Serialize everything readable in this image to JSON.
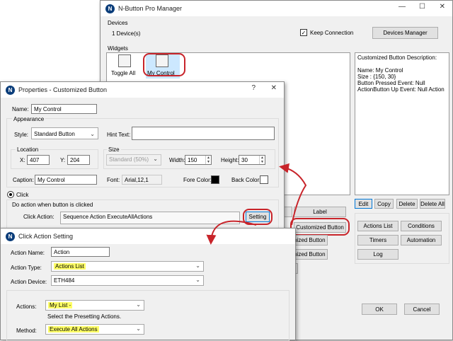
{
  "manager": {
    "title": "N-Button Pro Manager",
    "devices_label": "Devices",
    "device_count": "1 Device(s)",
    "keep_connection": "Keep Connection",
    "keep_connection_checked": true,
    "devices_manager_btn": "Devices Manager",
    "widgets_label": "Widgets",
    "widget_toggle_all": "Toggle All",
    "widget_my_control": "My Control",
    "desc_title": "Customized Button Description:",
    "desc_lines": [
      "Name: My Control",
      "Size : {150, 30}",
      "Button Pressed Event: Null",
      "ActionButton Up Event: Null Action"
    ],
    "btn_edit": "Edit",
    "btn_copy": "Copy",
    "btn_delete": "Delete",
    "btn_delete_all": "Delete All",
    "btn_label": "Label",
    "btn_customized_button": "Customized Button",
    "btn_customized_2": "omized Button",
    "btn_customized_3": "omized Button",
    "btn_actions_list": "Actions List",
    "btn_conditions": "Conditions",
    "btn_timers": "Timers",
    "btn_automation": "Automation",
    "btn_log": "Log",
    "btn_ok": "OK",
    "btn_cancel": "Cancel"
  },
  "props": {
    "title": "Properties - Customized Button",
    "name_label": "Name:",
    "name_value": "My Control",
    "appearance_label": "Appearance",
    "style_label": "Style:",
    "style_value": "Standard Button",
    "hint_label": "Hint Text:",
    "hint_value": "",
    "location_label": "Location",
    "x_label": "X:",
    "x_value": "407",
    "y_label": "Y:",
    "y_value": "204",
    "size_label": "Size",
    "size_combo": "Standard   (50%)",
    "width_label": "Width:",
    "width_value": "150",
    "height_label": "Height:",
    "height_value": "30",
    "caption_label": "Caption:",
    "caption_value": "My Control",
    "font_label": "Font:",
    "font_value": "Arial,12,1",
    "fore_label": "Fore Color:",
    "fore_color": "#000000",
    "back_label": "Back Color:",
    "back_color": "#ffffff",
    "click_label": "Click",
    "do_action_label": "Do action when button is clicked",
    "click_action_label": "Click Action:",
    "click_action_value": "Sequence Action ExecuteAllActions",
    "setting_btn": "Setting"
  },
  "cas": {
    "title": "Click Action Setting",
    "action_name_label": "Action Name:",
    "action_name_value": "Action",
    "action_type_label": "Action Type:",
    "action_type_value": "Actions List",
    "action_device_label": "Action Device:",
    "action_device_value": "ETH484",
    "actions_label": "Actions:",
    "actions_value": "My List -",
    "select_hint": "Select the Presetting Actions.",
    "method_label": "Method:",
    "method_value": "Execute All Actions"
  },
  "colors": {
    "annotation": "#c8242a",
    "highlight": "#ffff66",
    "selection": "#cce8ff"
  }
}
